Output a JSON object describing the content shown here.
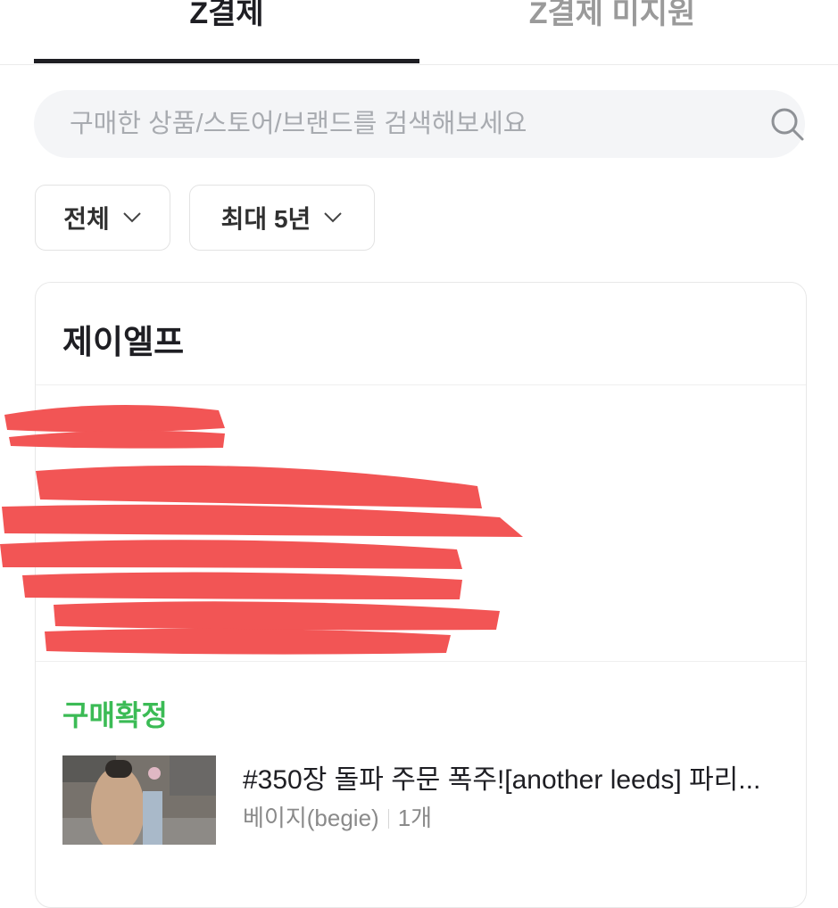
{
  "tabs": [
    {
      "label": "Z결제",
      "active": true
    },
    {
      "label": "Z결제 미지원",
      "active": false
    }
  ],
  "search": {
    "placeholder": "구매한 상품/스토어/브랜드를 검색해보세요",
    "value": ""
  },
  "filters": {
    "type_label": "전체",
    "period_label": "최대 5년"
  },
  "order": {
    "store": "제이엘프",
    "status": "구매확정",
    "status_color": "#3bbb55",
    "product_name": "#350장 돌파 주문 폭주![another leeds] 파리...",
    "option": "베이지(begie)",
    "quantity": "1개"
  },
  "icons": {
    "search": "search-icon",
    "dropdown": "chevron-down-icon"
  },
  "colors": {
    "redaction": "#f25555",
    "active_tab": "#1e1e23",
    "inactive_tab": "#9a9a9a"
  }
}
